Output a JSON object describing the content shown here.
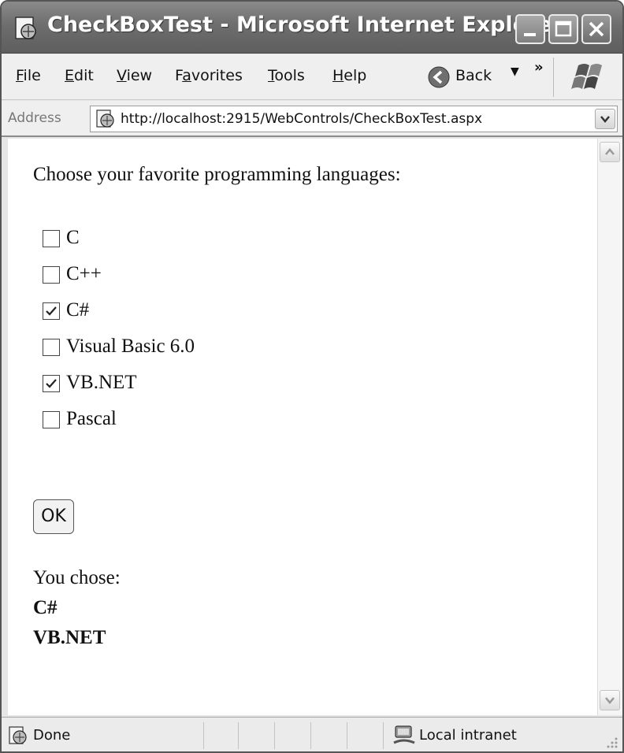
{
  "window": {
    "title": "CheckBoxTest - Microsoft Internet Explorer"
  },
  "menu": {
    "items": [
      {
        "label": "File",
        "accel": "F"
      },
      {
        "label": "Edit",
        "accel": "E"
      },
      {
        "label": "View",
        "accel": "V"
      },
      {
        "label": "Favorites",
        "accel": "a"
      },
      {
        "label": "Tools",
        "accel": "T"
      },
      {
        "label": "Help",
        "accel": "H"
      }
    ],
    "back_label": "Back",
    "chevrons": "»"
  },
  "address": {
    "label": "Address",
    "url": "http://localhost:2915/WebControls/CheckBoxTest.aspx"
  },
  "page": {
    "prompt": "Choose your favorite programming languages:",
    "options": [
      {
        "label": "C",
        "checked": false
      },
      {
        "label": "C++",
        "checked": false
      },
      {
        "label": "C#",
        "checked": true
      },
      {
        "label": "Visual Basic 6.0",
        "checked": false
      },
      {
        "label": "VB.NET",
        "checked": true
      },
      {
        "label": "Pascal",
        "checked": false
      }
    ],
    "ok_label": "OK",
    "result_label": "You chose:",
    "results": [
      "C#",
      "VB.NET"
    ]
  },
  "status": {
    "text": "Done",
    "zone": "Local intranet"
  },
  "icons": {
    "title": "ie-page-icon",
    "back": "back-arrow-icon",
    "logo": "windows-logo-icon",
    "page": "ie-page-icon",
    "zone": "intranet-icon"
  }
}
